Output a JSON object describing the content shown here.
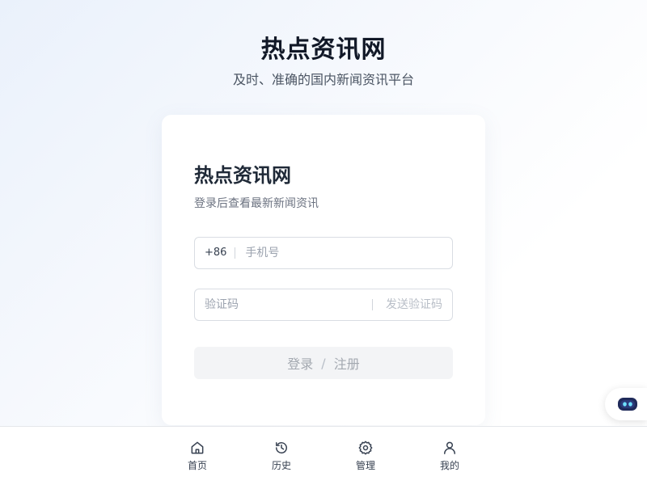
{
  "hero": {
    "title": "热点资讯网",
    "subtitle": "及时、准确的国内新闻资讯平台"
  },
  "login": {
    "title": "热点资讯网",
    "subtitle": "登录后查看最新新闻资讯",
    "phone": {
      "prefix": "+86",
      "placeholder": "手机号",
      "value": ""
    },
    "code": {
      "placeholder": "验证码",
      "value": "",
      "send_label": "发送验证码"
    },
    "submit": {
      "login_label": "登录",
      "separator": "/",
      "register_label": "注册"
    }
  },
  "assistant": {
    "icon": "robot-icon"
  },
  "tabbar": {
    "items": [
      {
        "label": "首页",
        "icon": "home-icon"
      },
      {
        "label": "历史",
        "icon": "history-icon"
      },
      {
        "label": "管理",
        "icon": "gear-icon"
      },
      {
        "label": "我的",
        "icon": "user-icon"
      }
    ]
  },
  "colors": {
    "text_primary": "#111827",
    "text_secondary": "#6b7280",
    "button_disabled_bg": "#f3f4f6",
    "robot_accent": "#1f2a5a"
  }
}
